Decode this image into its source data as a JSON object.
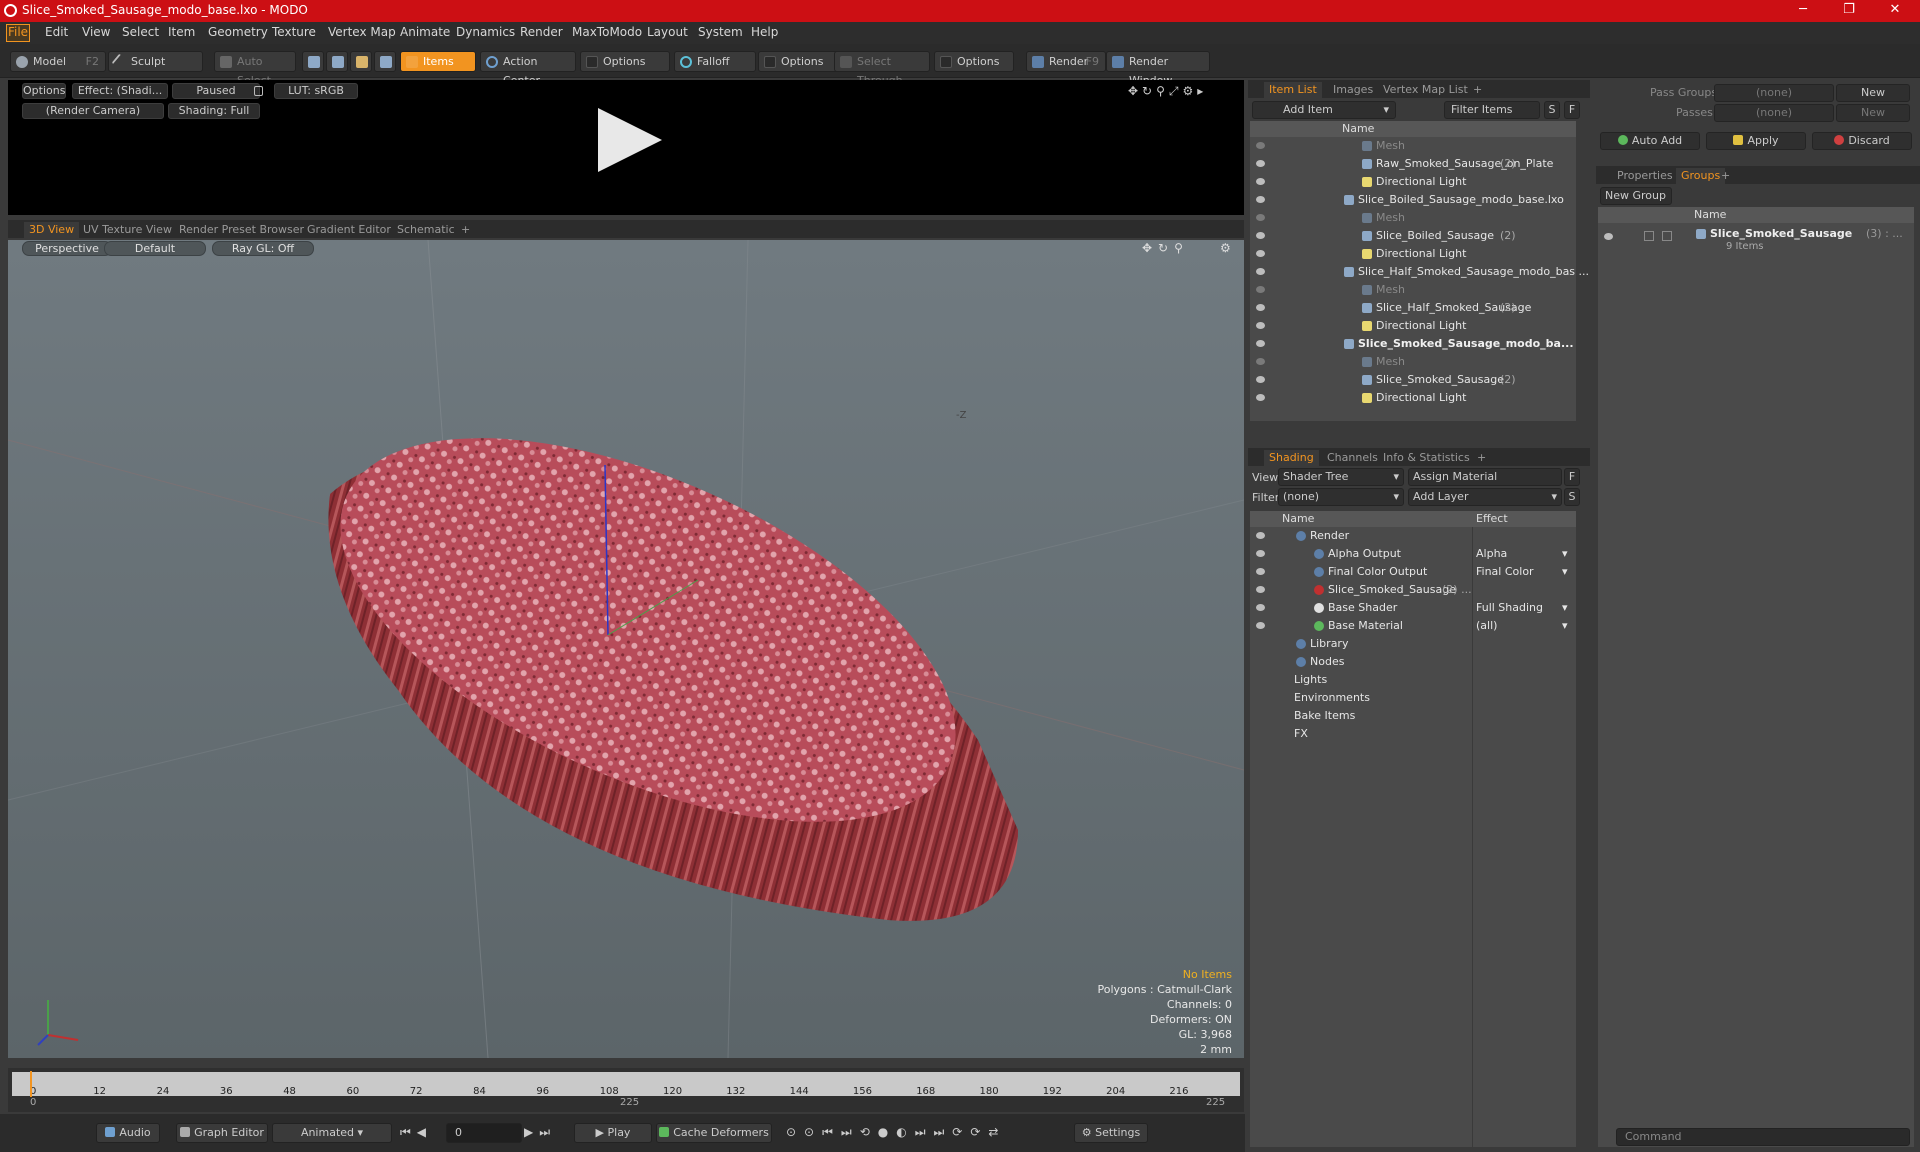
{
  "window": {
    "title": "Slice_Smoked_Sausage_modo_base.lxo - MODO",
    "min": "─",
    "max": "❐",
    "close": "✕"
  },
  "menu": [
    "File",
    "Edit",
    "View",
    "Select",
    "Item",
    "Geometry",
    "Texture",
    "Vertex Map",
    "Animate",
    "Dynamics",
    "Render",
    "MaxToModo",
    "Layout",
    "System",
    "Help"
  ],
  "toolbar": {
    "model": "Model",
    "model_key": "F2",
    "sculpt": "Sculpt",
    "auto_select": "Auto Select",
    "items": "Items",
    "action_center": "Action Center",
    "options1": "Options",
    "falloff": "Falloff",
    "options2": "Options",
    "select_through": "Select Through",
    "options3": "Options",
    "render": "Render",
    "render_key": "F9",
    "render_window": "Render Window"
  },
  "preview": {
    "options": "Options",
    "effect": "Effect: (Shadi...",
    "paused": "Paused",
    "lut": "LUT: sRGB",
    "camera": "(Render Camera)",
    "shading": "Shading: Full"
  },
  "viewport_tabs": [
    "3D View",
    "UV Texture View",
    "Render Preset Browser",
    "Gradient Editor",
    "Schematic",
    "+"
  ],
  "viewport": {
    "perspective": "Perspective",
    "default": "Default",
    "raygl": "Ray GL: Off",
    "axis_label": "-Z",
    "stats": [
      "No Items",
      "Polygons : Catmull-Clark",
      "Channels: 0",
      "Deformers: ON",
      "GL: 3,968",
      "2 mm"
    ]
  },
  "timeline": {
    "ticks": [
      "0",
      "12",
      "24",
      "36",
      "48",
      "60",
      "72",
      "84",
      "96",
      "108",
      "120",
      "132",
      "144",
      "156",
      "168",
      "180",
      "192",
      "204",
      "216"
    ],
    "start": "0",
    "mid": "225",
    "end": "225"
  },
  "bottombar": {
    "audio": "Audio",
    "graph_editor": "Graph Editor",
    "animated": "Animated",
    "frame": "0",
    "play": "Play",
    "cache_deformers": "Cache Deformers",
    "settings": "Settings"
  },
  "itemlist": {
    "tabs": [
      "Item List",
      "Images",
      "Vertex Map List",
      "+"
    ],
    "add_item": "Add Item",
    "filter_items": "Filter Items",
    "col_name": "Name",
    "rows": [
      {
        "label": "Mesh",
        "count": "",
        "indent": 3,
        "dim": true
      },
      {
        "label": "Raw_Smoked_Sausage_on_Plate",
        "count": "(2)",
        "indent": 3,
        "dim": false
      },
      {
        "label": "Directional Light",
        "count": "",
        "indent": 3,
        "dim": false
      },
      {
        "label": "Slice_Boiled_Sausage_modo_base.lxo",
        "count": "",
        "indent": 2,
        "dim": false
      },
      {
        "label": "Mesh",
        "count": "",
        "indent": 3,
        "dim": true
      },
      {
        "label": "Slice_Boiled_Sausage",
        "count": "(2)",
        "indent": 3,
        "dim": false
      },
      {
        "label": "Directional Light",
        "count": "",
        "indent": 3,
        "dim": false
      },
      {
        "label": "Slice_Half_Smoked_Sausage_modo_bas ...",
        "count": "",
        "indent": 2,
        "dim": false
      },
      {
        "label": "Mesh",
        "count": "",
        "indent": 3,
        "dim": true
      },
      {
        "label": "Slice_Half_Smoked_Sausage",
        "count": "(2)",
        "indent": 3,
        "dim": false
      },
      {
        "label": "Directional Light",
        "count": "",
        "indent": 3,
        "dim": false
      },
      {
        "label": "Slice_Smoked_Sausage_modo_ba...",
        "count": "",
        "indent": 2,
        "dim": false,
        "bold": true
      },
      {
        "label": "Mesh",
        "count": "",
        "indent": 3,
        "dim": true
      },
      {
        "label": "Slice_Smoked_Sausage",
        "count": "(2)",
        "indent": 3,
        "dim": false
      },
      {
        "label": "Directional Light",
        "count": "",
        "indent": 3,
        "dim": false
      }
    ]
  },
  "shading": {
    "tabs": [
      "Shading",
      "Channels",
      "Info & Statistics",
      "+"
    ],
    "view_label": "View",
    "view_value": "Shader Tree",
    "assign_material": "Assign Material",
    "filter_label": "Filter",
    "filter_value": "(none)",
    "add_layer": "Add Layer",
    "col_name": "Name",
    "col_effect": "Effect",
    "rows": [
      {
        "label": "Render",
        "effect": "",
        "indent": 1
      },
      {
        "label": "Alpha Output",
        "effect": "Alpha",
        "indent": 2
      },
      {
        "label": "Final Color Output",
        "effect": "Final Color",
        "indent": 2
      },
      {
        "label": "Slice_Smoked_Sausage",
        "count": "(2) ...",
        "effect": "",
        "indent": 2
      },
      {
        "label": "Base Shader",
        "effect": "Full Shading",
        "indent": 2
      },
      {
        "label": "Base Material",
        "effect": "(all)",
        "indent": 2
      },
      {
        "label": "Library",
        "effect": "",
        "indent": 1
      },
      {
        "label": "Nodes",
        "effect": "",
        "indent": 1
      },
      {
        "label": "Lights",
        "effect": "",
        "indent": 0
      },
      {
        "label": "Environments",
        "effect": "",
        "indent": 0
      },
      {
        "label": "Bake Items",
        "effect": "",
        "indent": 0
      },
      {
        "label": "FX",
        "effect": "",
        "indent": 0
      }
    ]
  },
  "groups": {
    "pass_groups": "Pass Groups",
    "pass_value": "(none)",
    "new": "New",
    "passes": "Passes",
    "passes_value": "(none)",
    "new2": "New",
    "auto_add": "Auto Add",
    "apply": "Apply",
    "discard": "Discard",
    "tabs": [
      "Properties",
      "Groups",
      "+"
    ],
    "new_group": "New Group",
    "col_name": "Name",
    "group_name": "Slice_Smoked_Sausage",
    "group_count": "(3) : ...",
    "group_items": "9 Items"
  },
  "command": {
    "placeholder": "Command"
  }
}
